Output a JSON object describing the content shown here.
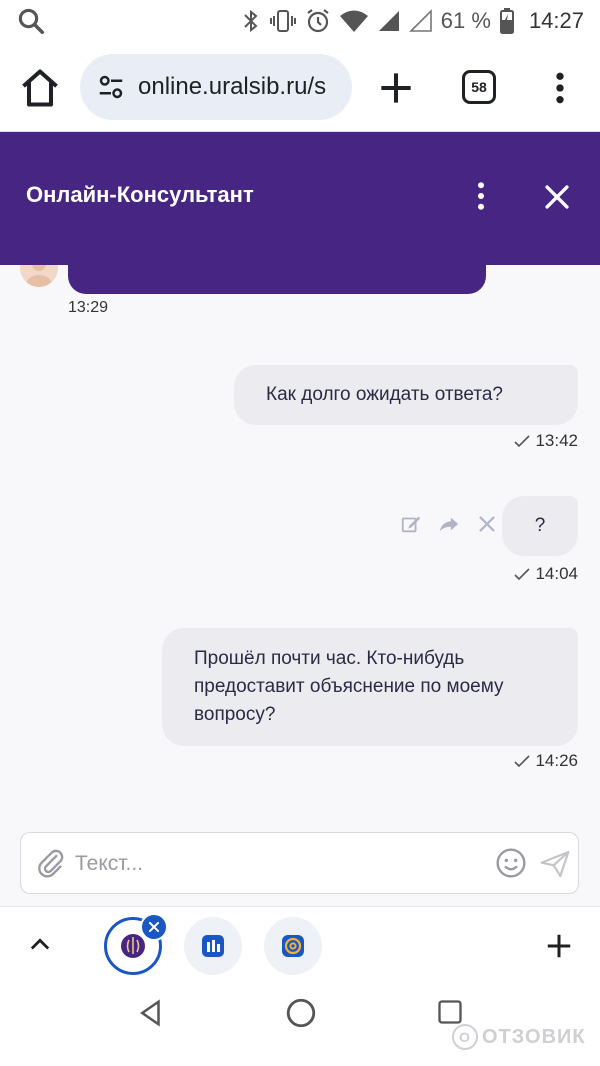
{
  "status_bar": {
    "battery": "61 %",
    "time": "14:27"
  },
  "browser": {
    "url": "online.uralsib.ru/s",
    "tab_count": "58"
  },
  "chat": {
    "title": "Онлайн-Консультант",
    "operator_time": "13:29",
    "messages": [
      {
        "text": "Как долго ожидать ответа?",
        "time": "13:42"
      },
      {
        "text": "?",
        "time": "14:04"
      },
      {
        "text": "Прошёл почти час. Кто-нибудь предоставит объяснение по моему вопросу?",
        "time": "14:26"
      }
    ],
    "input_placeholder": "Текст..."
  },
  "watermark": {
    "text": "ОТЗОВИК",
    "badge": "О"
  },
  "colors": {
    "header": "#472582",
    "bubble": "#ececf0",
    "tab_accent": "#1a56c4"
  }
}
